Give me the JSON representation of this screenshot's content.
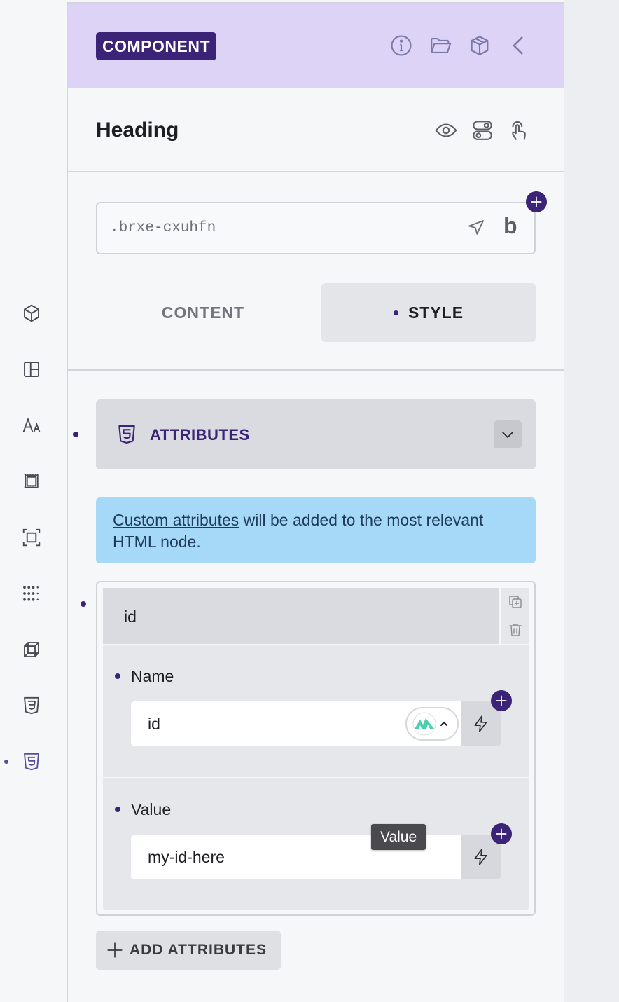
{
  "header": {
    "badge": "COMPONENT",
    "icons": [
      "info-icon",
      "folder-open-icon",
      "box-icon",
      "chevron-left-icon"
    ]
  },
  "element": {
    "title": "Heading",
    "icons": [
      "eye-icon",
      "toggle-icon",
      "pointer-hand-icon"
    ]
  },
  "selector": {
    "value": ".brxe-cxuhfn",
    "b_glyph": "b"
  },
  "tabs": {
    "content": "CONTENT",
    "style": "STYLE",
    "active": "STYLE"
  },
  "attributes_section": {
    "title": "ATTRIBUTES",
    "info_link": "Custom attributes",
    "info_rest": " will be added to the most relevant HTML node."
  },
  "repeater": {
    "item_label": "id",
    "name_label": "Name",
    "name_value": "id",
    "value_label": "Value",
    "value_value": "my-id-here"
  },
  "tooltip": "Value",
  "add_button": "ADD ATTRIBUTES",
  "rail": {
    "icons": [
      "cube-icon",
      "layout-icon",
      "typography-icon",
      "spacing-icon",
      "size-icon",
      "grid-dots-icon",
      "transform-icon",
      "css3-icon",
      "html5-icon"
    ],
    "active": "html5-icon"
  },
  "colors": {
    "accent": "#3b2378",
    "header_bg": "#ddd3f7",
    "info_bg": "#a6d8f8"
  }
}
